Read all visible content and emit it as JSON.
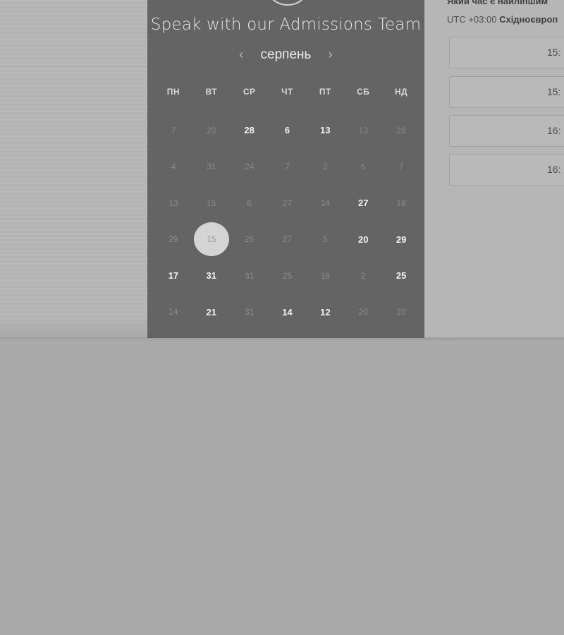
{
  "calendar": {
    "heading": "Speak with our Admissions Team",
    "month": "серпень",
    "prev_icon": "‹",
    "next_icon": "›",
    "weekdays": [
      "ПН",
      "ВТ",
      "СР",
      "ЧТ",
      "ПТ",
      "СБ",
      "НД"
    ],
    "weeks": [
      [
        {
          "d": "7",
          "a": false
        },
        {
          "d": "23",
          "a": false
        },
        {
          "d": "28",
          "a": true
        },
        {
          "d": "6",
          "a": true
        },
        {
          "d": "13",
          "a": true
        },
        {
          "d": "13",
          "a": false
        },
        {
          "d": "28",
          "a": false
        }
      ],
      [
        {
          "d": "4",
          "a": false
        },
        {
          "d": "31",
          "a": false
        },
        {
          "d": "24",
          "a": false
        },
        {
          "d": "7",
          "a": false
        },
        {
          "d": "2",
          "a": false
        },
        {
          "d": "6",
          "a": false
        },
        {
          "d": "7",
          "a": false
        }
      ],
      [
        {
          "d": "13",
          "a": false
        },
        {
          "d": "15",
          "a": false
        },
        {
          "d": "6",
          "a": false
        },
        {
          "d": "27",
          "a": false
        },
        {
          "d": "14",
          "a": false
        },
        {
          "d": "27",
          "a": true
        },
        {
          "d": "18",
          "a": false
        }
      ],
      [
        {
          "d": "29",
          "a": false
        },
        {
          "d": "15",
          "a": false,
          "selected": true
        },
        {
          "d": "25",
          "a": false
        },
        {
          "d": "27",
          "a": false
        },
        {
          "d": "5",
          "a": false
        },
        {
          "d": "20",
          "a": true
        },
        {
          "d": "29",
          "a": true
        }
      ],
      [
        {
          "d": "17",
          "a": true
        },
        {
          "d": "31",
          "a": true
        },
        {
          "d": "31",
          "a": false
        },
        {
          "d": "25",
          "a": false
        },
        {
          "d": "18",
          "a": false
        },
        {
          "d": "2",
          "a": false
        },
        {
          "d": "25",
          "a": true
        }
      ],
      [
        {
          "d": "14",
          "a": false
        },
        {
          "d": "21",
          "a": true
        },
        {
          "d": "31",
          "a": false
        },
        {
          "d": "14",
          "a": true
        },
        {
          "d": "12",
          "a": true
        },
        {
          "d": "20",
          "a": false
        },
        {
          "d": "20",
          "a": false
        }
      ]
    ]
  },
  "times": {
    "question": "Який час є найліпшим",
    "timezone_offset": "UTC +03:00",
    "timezone_name": "Східноєвроп",
    "slots": [
      "15:",
      "15:",
      "16:",
      "16:"
    ]
  },
  "colors": {
    "panel": "#646464",
    "selected_day": "#d4d4d4",
    "page_bg": "#a9a9a9"
  }
}
